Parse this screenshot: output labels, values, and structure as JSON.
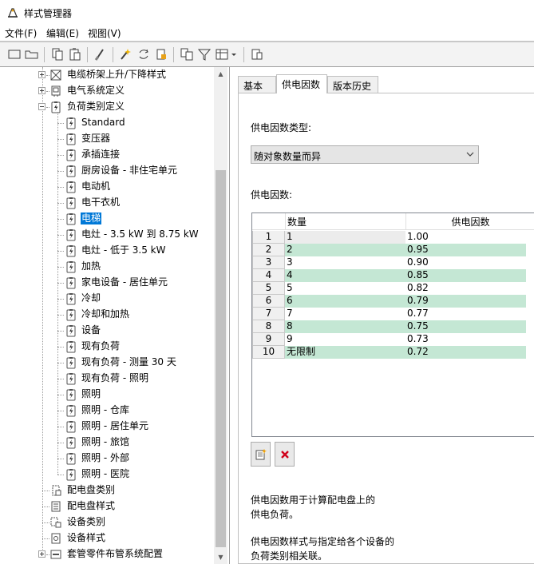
{
  "window": {
    "title": "样式管理器",
    "icon": "style-manager-icon"
  },
  "menu": [
    "文件(F)",
    "编辑(E)",
    "视图(V)"
  ],
  "toolbar": {
    "buttons": [
      {
        "name": "new-icon"
      },
      {
        "name": "open-folder-icon"
      },
      {
        "name": "copy-icon"
      },
      {
        "name": "paste-icon"
      },
      {
        "name": "purge-icon"
      },
      {
        "name": "edit-style-icon"
      },
      {
        "name": "synchronize-icon"
      },
      {
        "name": "lock-file-icon"
      },
      {
        "name": "compare-icon"
      },
      {
        "name": "filter-icon"
      },
      {
        "name": "view-toggle-icon"
      },
      {
        "name": "help-icon"
      }
    ]
  },
  "tree": {
    "items": [
      {
        "label": "电缆桥架上升/下降样式",
        "icon": "cable-tray-rise-icon",
        "level": 1,
        "expander": "plus"
      },
      {
        "label": "电气系统定义",
        "icon": "electrical-system-icon",
        "level": 1,
        "expander": "plus"
      },
      {
        "label": "负荷类别定义",
        "icon": "load-class-icon",
        "level": 1,
        "expander": "minus"
      },
      {
        "label": "Standard",
        "icon": "load-class-icon",
        "level": 2
      },
      {
        "label": "变压器",
        "icon": "load-class-icon",
        "level": 2
      },
      {
        "label": "承插连接",
        "icon": "load-class-icon",
        "level": 2
      },
      {
        "label": "厨房设备 - 非住宅单元",
        "icon": "load-class-icon",
        "level": 2
      },
      {
        "label": "电动机",
        "icon": "load-class-icon",
        "level": 2
      },
      {
        "label": "电干衣机",
        "icon": "load-class-icon",
        "level": 2
      },
      {
        "label": "电梯",
        "icon": "load-class-icon",
        "level": 2,
        "selected": true
      },
      {
        "label": "电灶 - 3.5 kW 到 8.75 kW",
        "icon": "load-class-icon",
        "level": 2
      },
      {
        "label": "电灶 - 低于 3.5 kW",
        "icon": "load-class-icon",
        "level": 2
      },
      {
        "label": "加热",
        "icon": "load-class-icon",
        "level": 2
      },
      {
        "label": "家电设备 - 居住单元",
        "icon": "load-class-icon",
        "level": 2
      },
      {
        "label": "冷却",
        "icon": "load-class-icon",
        "level": 2
      },
      {
        "label": "冷却和加热",
        "icon": "load-class-icon",
        "level": 2
      },
      {
        "label": "设备",
        "icon": "load-class-icon",
        "level": 2
      },
      {
        "label": "现有负荷",
        "icon": "load-class-icon",
        "level": 2
      },
      {
        "label": "现有负荷 - 测量 30 天",
        "icon": "load-class-icon",
        "level": 2
      },
      {
        "label": "现有负荷 - 照明",
        "icon": "load-class-icon",
        "level": 2
      },
      {
        "label": "照明",
        "icon": "load-class-icon",
        "level": 2
      },
      {
        "label": "照明 - 仓库",
        "icon": "load-class-icon",
        "level": 2
      },
      {
        "label": "照明 - 居住单元",
        "icon": "load-class-icon",
        "level": 2
      },
      {
        "label": "照明 - 旅馆",
        "icon": "load-class-icon",
        "level": 2
      },
      {
        "label": "照明 - 外部",
        "icon": "load-class-icon",
        "level": 2
      },
      {
        "label": "照明 - 医院",
        "icon": "load-class-icon",
        "level": 2
      },
      {
        "label": "配电盘类别",
        "icon": "panel-category-icon",
        "level": 1
      },
      {
        "label": "配电盘样式",
        "icon": "panel-style-icon",
        "level": 1
      },
      {
        "label": "设备类别",
        "icon": "device-category-icon",
        "level": 1
      },
      {
        "label": "设备样式",
        "icon": "device-style-icon",
        "level": 1
      },
      {
        "label": "套管零件布管系统配置",
        "icon": "conduit-config-icon",
        "level": 1,
        "expander": "plus"
      }
    ]
  },
  "tabs": [
    {
      "label": "基本",
      "active": false
    },
    {
      "label": "供电因数",
      "active": true
    },
    {
      "label": "版本历史",
      "active": false
    }
  ],
  "demand": {
    "type_label": "供电因数类型:",
    "type_value": "随对象数量而异",
    "factors_label": "供电因数:",
    "columns": [
      "数量",
      "供电因数"
    ],
    "rows": [
      {
        "n": "1",
        "qty": "1",
        "factor": "1.00"
      },
      {
        "n": "2",
        "qty": "2",
        "factor": "0.95"
      },
      {
        "n": "3",
        "qty": "3",
        "factor": "0.90"
      },
      {
        "n": "4",
        "qty": "4",
        "factor": "0.85"
      },
      {
        "n": "5",
        "qty": "5",
        "factor": "0.82"
      },
      {
        "n": "6",
        "qty": "6",
        "factor": "0.79"
      },
      {
        "n": "7",
        "qty": "7",
        "factor": "0.77"
      },
      {
        "n": "8",
        "qty": "8",
        "factor": "0.75"
      },
      {
        "n": "9",
        "qty": "9",
        "factor": "0.73"
      },
      {
        "n": "10",
        "qty": "无限制",
        "factor": "0.72"
      }
    ],
    "add_button_icon": "add-row-icon",
    "delete_button_icon": "delete-row-icon",
    "help_1_line1": "供电因数用于计算配电盘上的",
    "help_1_line2": "供电负荷。",
    "help_2_line1": "供电因数样式与指定给各个设备的",
    "help_2_line2": "负荷类别相关联。"
  },
  "colors": {
    "alt_row": "#c4e7d4",
    "selection": "#0078d7",
    "delete_x": "#d0021b"
  }
}
